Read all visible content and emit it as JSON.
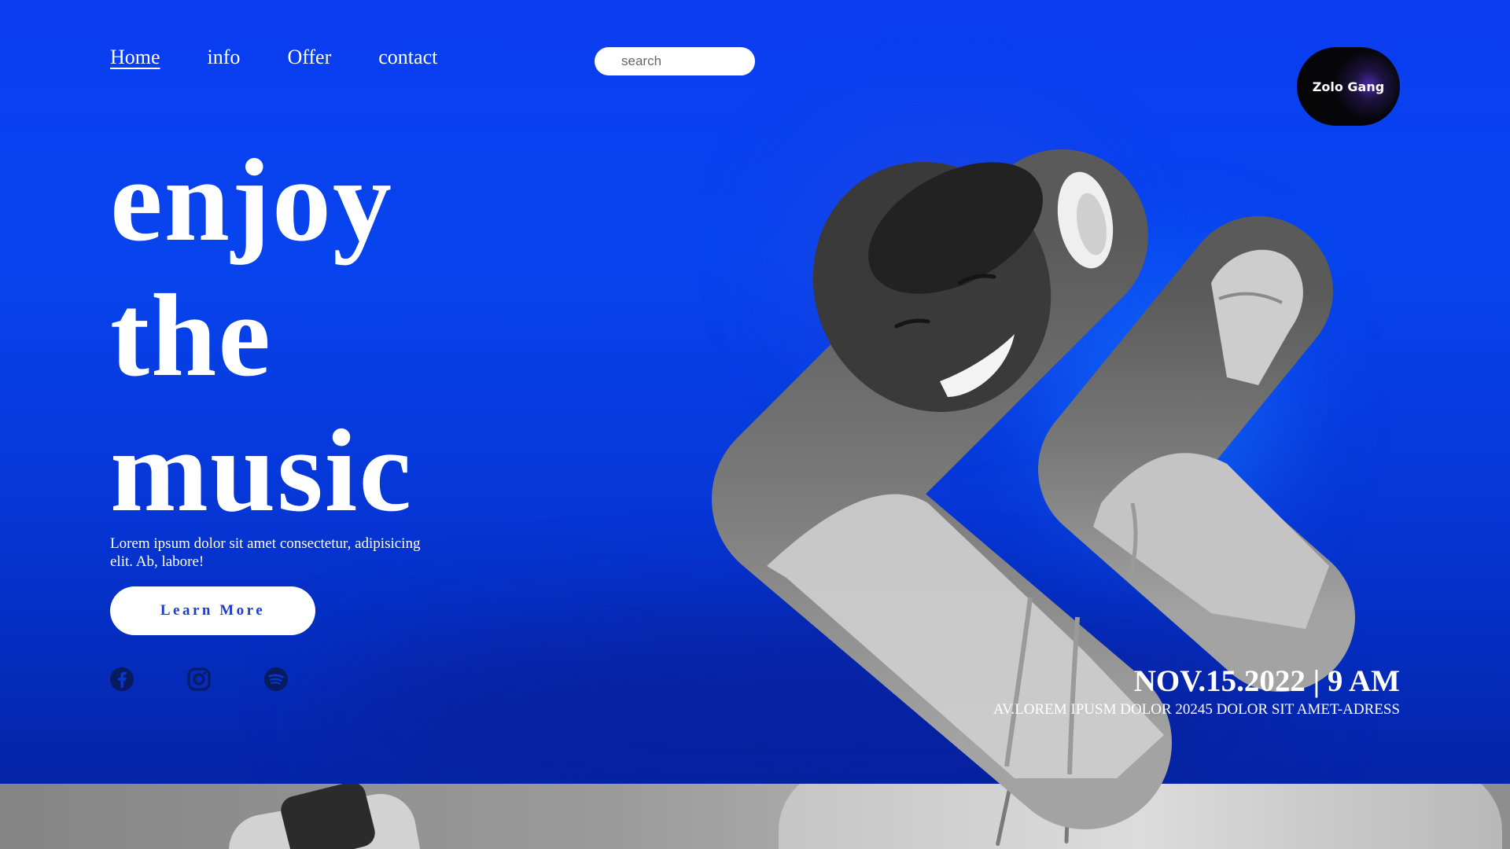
{
  "nav": {
    "items": [
      {
        "label": "Home",
        "active": true
      },
      {
        "label": "info",
        "active": false
      },
      {
        "label": "Offer",
        "active": false
      },
      {
        "label": "contact",
        "active": false
      }
    ]
  },
  "search": {
    "placeholder": "search",
    "value": ""
  },
  "logo": {
    "label": "Zolo Gang"
  },
  "hero": {
    "line1": "enjoy",
    "line2": "the",
    "line3": "music",
    "description": "Lorem ipsum dolor sit amet consectetur, adipisicing elit. Ab, labore!",
    "cta_label": "Learn More"
  },
  "socials": [
    "facebook-icon",
    "instagram-icon",
    "spotify-icon"
  ],
  "event": {
    "date": "NOV.15.2022 | 9 AM",
    "address": "AV.LOREM IPUSM DOLOR 20245 DOLOR SIT AMET-ADRESS"
  },
  "colors": {
    "background": "#0a3df0",
    "button_text": "#1c3ad6",
    "logo_bg": "#050505",
    "photo_gray": "#8a8a8a"
  }
}
